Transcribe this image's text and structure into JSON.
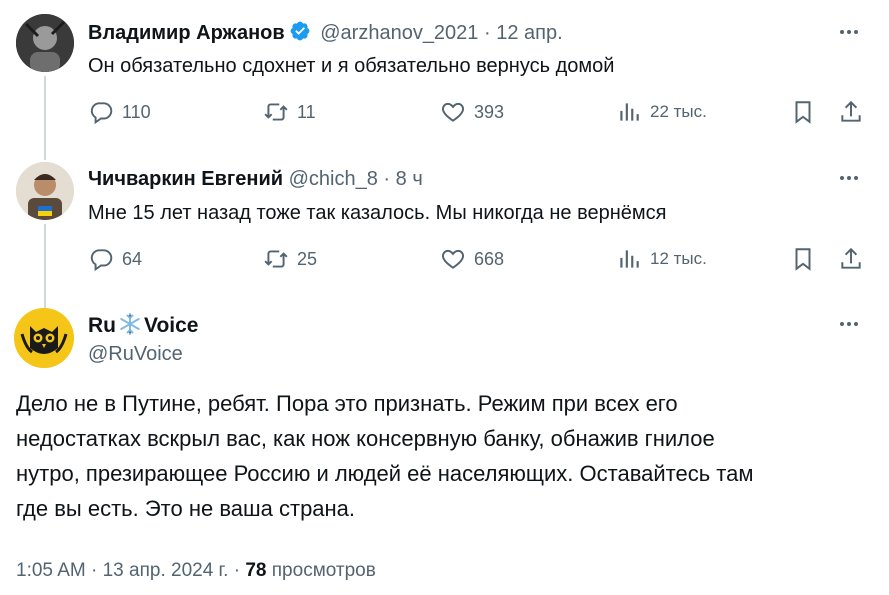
{
  "tweets": [
    {
      "name": "Владимир Аржанов",
      "handle": "@arzhanov_2021",
      "separator": "·",
      "time": "12 апр.",
      "text": "Он обязательно сдохнет и я обязательно вернусь домой",
      "actions": {
        "replies": "110",
        "retweets": "11",
        "likes": "393",
        "views": "22 тыс."
      }
    },
    {
      "name": "Чичваркин Евгений",
      "handle": "@chich_8",
      "separator": "·",
      "time": "8 ч",
      "text": "Мне 15 лет назад тоже так казалось.  Мы никогда не вернёмся",
      "actions": {
        "replies": "64",
        "retweets": "25",
        "likes": "668",
        "views": "12 тыс."
      }
    }
  ],
  "main": {
    "name_prefix": "Ru",
    "name_suffix": "Voice",
    "handle": "@RuVoice",
    "text_lines": [
      "Дело не в Путине, ребят. Пора это признать. Режим при всех его",
      "недостатках вскрыл вас, как нож консервную банку, обнажив гнилое",
      "нутро, презирающее Россию и людей её населяющих. Оставайтесь там",
      "где вы есть. Это не ваша страна."
    ],
    "time": "1:05 AM",
    "date": "13 апр. 2024 г.",
    "separator": "·",
    "views_count": "78",
    "views_label": "просмотров"
  },
  "icons": {
    "verified": "verified-badge-icon",
    "more": "more-dots-icon",
    "reply": "reply-icon",
    "retweet": "retweet-icon",
    "like": "heart-icon",
    "views": "views-bar-icon",
    "bookmark": "bookmark-icon",
    "share": "share-icon",
    "snowflake": "snowflake-icon"
  },
  "colors": {
    "text": "#0f1419",
    "muted": "#536471",
    "verified": "#1d9bf0",
    "thread_line": "#cfd9de",
    "ruvoice_bg": "#f5c518"
  }
}
